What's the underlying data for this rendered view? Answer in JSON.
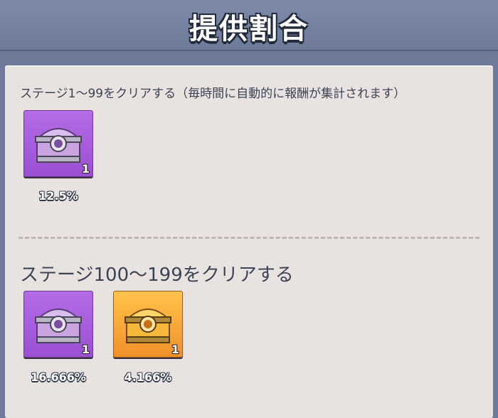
{
  "header": {
    "title": "提供割合"
  },
  "sections": [
    {
      "title": "ステージ1～99をクリアする（毎時間に自動的に報酬が集計されます）",
      "rewards": [
        {
          "icon": "purple-chest-icon",
          "color": "#9b4fd3",
          "quantity": "1",
          "rate": "12.5%"
        }
      ]
    },
    {
      "title": "ステージ100～199をクリアする",
      "rewards": [
        {
          "icon": "purple-chest-icon",
          "color": "#9b4fd3",
          "quantity": "1",
          "rate": "16.666%"
        },
        {
          "icon": "gold-chest-icon",
          "color": "#f0902a",
          "quantity": "1",
          "rate": "4.166%"
        }
      ]
    }
  ]
}
